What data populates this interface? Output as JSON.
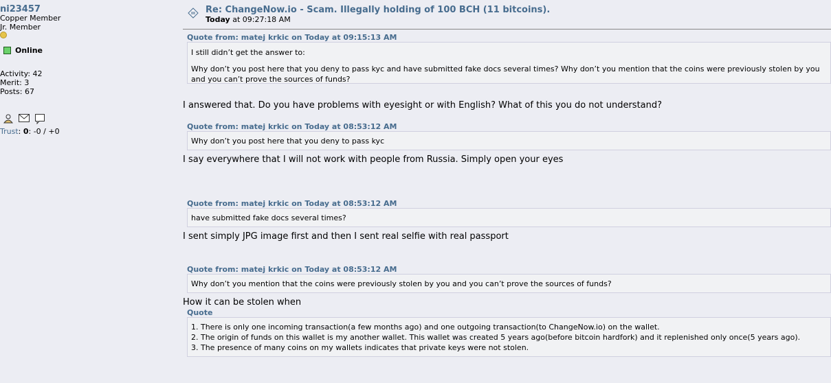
{
  "poster": {
    "name": "ni23457",
    "rank": "Copper Member",
    "rank2": "Jr. Member",
    "status": "Online",
    "activity": "Activity: 42",
    "merit": "Merit: 3",
    "posts": "Posts: 67",
    "trust_label": "Trust",
    "trust_value": "0",
    "trust_rest": ": -0 / +0"
  },
  "post": {
    "title": "Re: ChangeNow.io - Scam. Illegally holding of 100 BCH (11 bitcoins).",
    "date_bold": "Today",
    "date_rest": " at 09:27:18 AM"
  },
  "blocks": {
    "q1_header": "Quote from: matej krkic on Today at 09:15:13 AM",
    "q1_line1": "I still didn’t get the answer to:",
    "q1_line2": "Why don’t you post here that you deny to pass kyc and have submitted fake docs several times? Why don’t you mention that the coins were previously  stolen by you and you can’t prove the sources of funds?",
    "a1": "I answered that. Do you have problems with eyesight or with English? What of this you do not understand?",
    "q2_header": "Quote from: matej krkic on Today at 08:53:12 AM",
    "q2_body": "Why don’t you post here that you deny to pass kyc",
    "a2": "I say everywhere that I will not work with people from Russia. Simply open your eyes",
    "q3_header": "Quote from: matej krkic on Today at 08:53:12 AM",
    "q3_body": "have submitted fake docs several times?",
    "a3": "I sent simply JPG image first and then I sent real selfie with real passport",
    "q4_header": "Quote from: matej krkic on Today at 08:53:12 AM",
    "q4_body": "Why don’t you mention that the coins were previously  stolen by you and you can’t prove the sources of funds?",
    "a4": "How it can be stolen when",
    "q5_header": "Quote",
    "q5_items": [
      "1. There is only one incoming transaction(a few months ago) and one outgoing transaction(to ChangeNow.io) on the wallet.",
      "2. The origin of funds on this wallet is my another wallet. This wallet was created 5 years ago(before bitcoin hardfork) and it replenished only once(5 years ago).",
      "3. The presence of many coins on my wallets indicates that private keys were not stolen."
    ]
  },
  "icons": [
    "profile-icon",
    "message-icon",
    "trust-feedback-icon",
    "coin-icon",
    "post-icon"
  ],
  "colors": {
    "link": "#476c8e",
    "background": "#ecedf3",
    "quote_bg": "#f1f2f4",
    "online": "#6bd26b"
  }
}
